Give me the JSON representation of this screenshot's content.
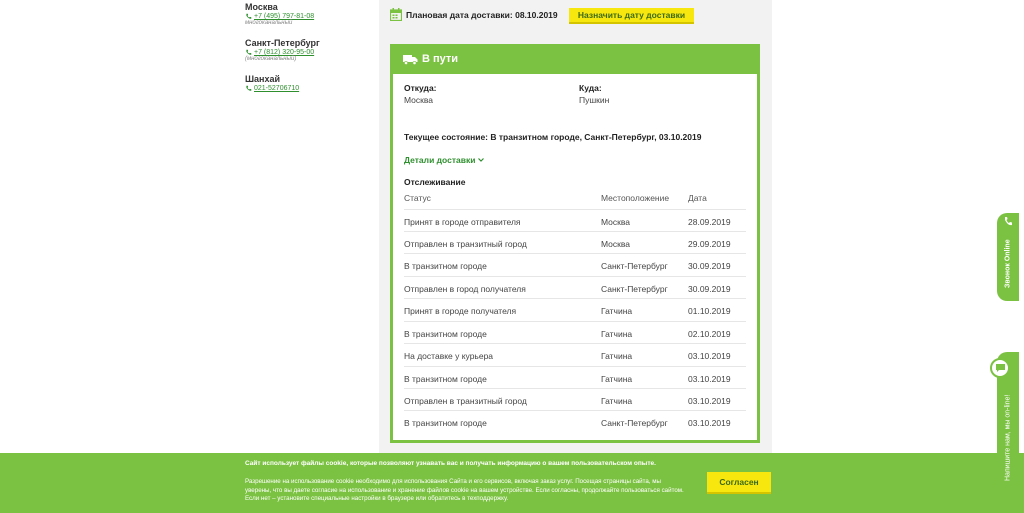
{
  "contacts": [
    {
      "city": "Москва",
      "phone": "+7 (495) 797-81-08",
      "note": "многоканальный"
    },
    {
      "city": "Санкт-Петербург",
      "phone": "+7 (812) 320-95-00",
      "note": "(многоканальный)"
    },
    {
      "city": "Шанхай",
      "phone": "021-52706710",
      "note": ""
    }
  ],
  "plan": {
    "text": "Плановая дата доставки: 08.10.2019",
    "assign_button": "Назначить дату доставки"
  },
  "card": {
    "title": "В пути",
    "from_label": "Откуда:",
    "from_value": "Москва",
    "to_label": "Куда:",
    "to_value": "Пушкин",
    "current_state": "Текущее состояние: В транзитном городе, Санкт-Петербург, 03.10.2019",
    "details_link": "Детали доставки",
    "tracking_title": "Отслеживание",
    "columns": {
      "status": "Статус",
      "location": "Местоположение",
      "date": "Дата"
    },
    "rows": [
      {
        "status": "Принят в городе отправителя",
        "location": "Москва",
        "date": "28.09.2019"
      },
      {
        "status": "Отправлен в транзитный город",
        "location": "Москва",
        "date": "29.09.2019"
      },
      {
        "status": "В транзитном городе",
        "location": "Санкт-Петербург",
        "date": "30.09.2019"
      },
      {
        "status": "Отправлен в город получателя",
        "location": "Санкт-Петербург",
        "date": "30.09.2019"
      },
      {
        "status": "Принят в городе получателя",
        "location": "Гатчина",
        "date": "01.10.2019"
      },
      {
        "status": "В транзитном городе",
        "location": "Гатчина",
        "date": "02.10.2019"
      },
      {
        "status": "На доставке у курьера",
        "location": "Гатчина",
        "date": "03.10.2019"
      },
      {
        "status": "В транзитном городе",
        "location": "Гатчина",
        "date": "03.10.2019"
      },
      {
        "status": "Отправлен в транзитный город",
        "location": "Гатчина",
        "date": "03.10.2019"
      },
      {
        "status": "В транзитном городе",
        "location": "Санкт-Петербург",
        "date": "03.10.2019"
      }
    ]
  },
  "cookie": {
    "bold_text": "Сайт использует файлы cookie, которые позволяют узнавать вас и получать информацию о вашем пользовательском опыте.",
    "text": "Разрешение на использование cookie необходимо для использования Сайта и его сервисов, включая заказ услуг. Посещая страницы сайта, мы уверены, что вы даете согласие на использование и хранение файлов cookie на вашем устройстве. Если согласны, продолжайте пользоваться сайтом. Если нет – установите специальные настройки в браузере или обратитесь в техподдержку.",
    "agree_button": "Согласен"
  },
  "widgets": {
    "call_label": "Звонок Online",
    "chat_label": "Напишите нам, мы on-line!"
  },
  "colors": {
    "accent": "#7cc242",
    "button": "#f7e70e",
    "link": "#2f8f2f"
  }
}
